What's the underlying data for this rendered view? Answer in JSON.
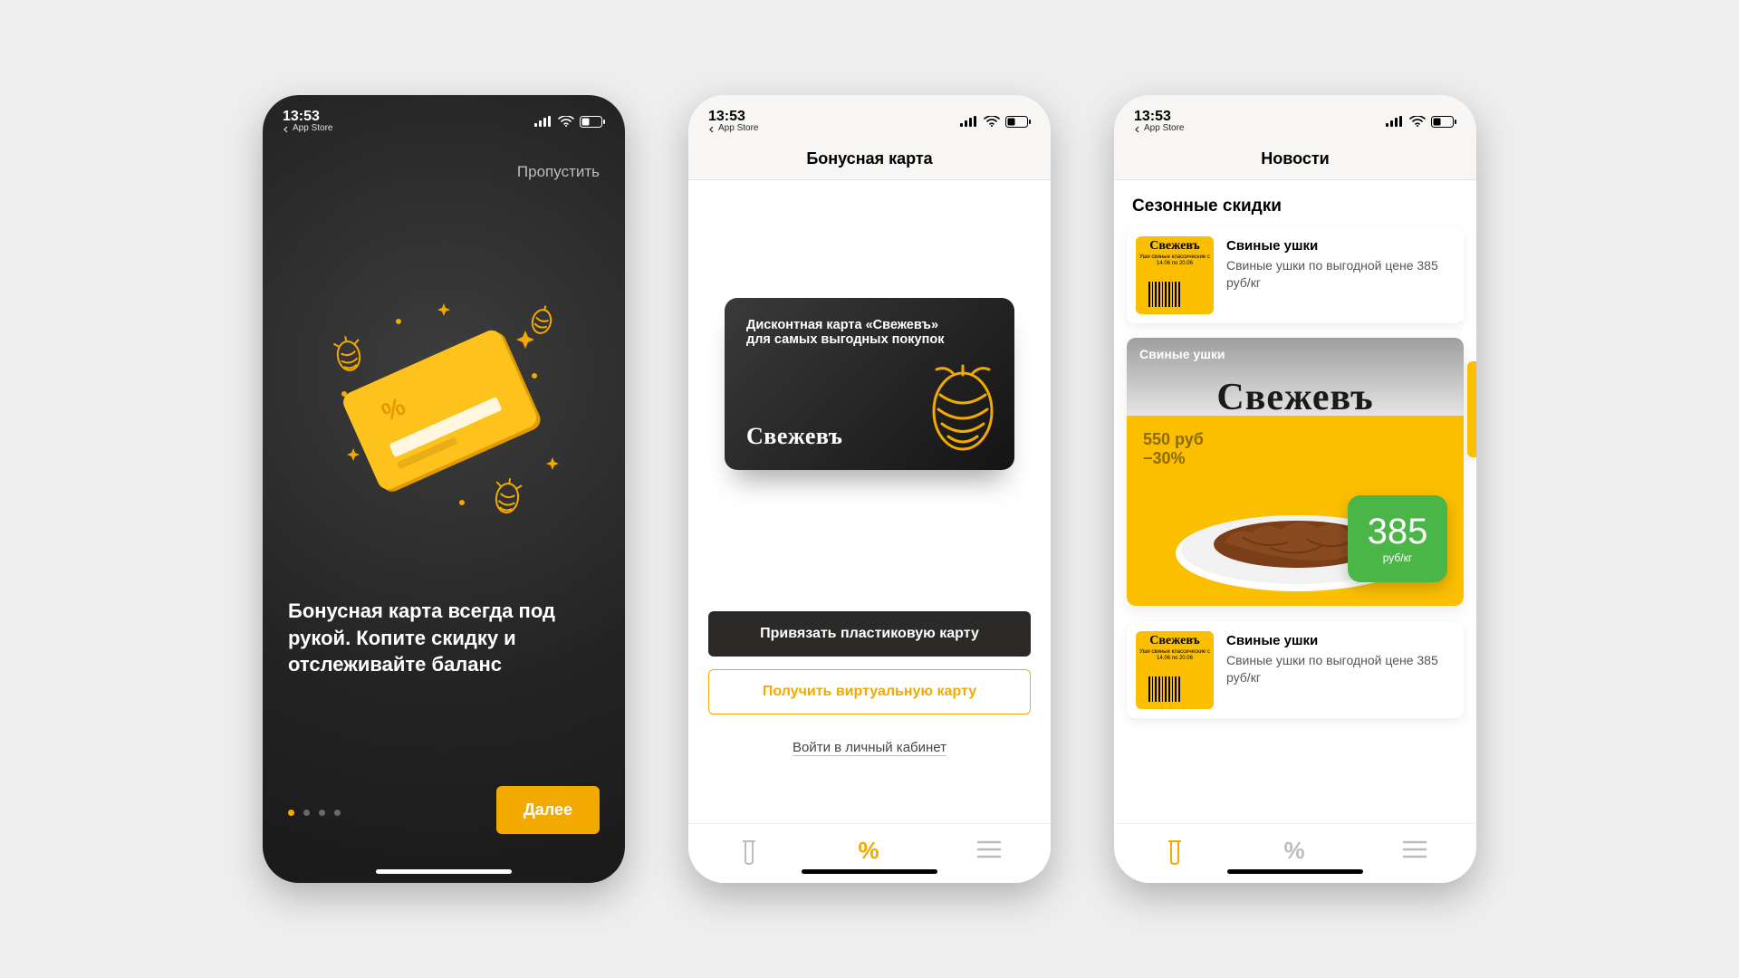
{
  "status": {
    "time": "13:53",
    "back_label": "App Store"
  },
  "colors": {
    "accent": "#f2a900",
    "promo_yellow": "#fbbf00",
    "price_green": "#4bb648"
  },
  "brand_name": "Свежевъ",
  "onboarding": {
    "skip": "Пропустить",
    "headline": "Бонусная карта всегда под рукой. Копите скидку и отслеживайте баланс",
    "next": "Далее",
    "page_count": 4,
    "page_active_index": 0
  },
  "bonus": {
    "nav_title": "Бонусная карта",
    "card_line1": "Дисконтная карта «Свежевъ»",
    "card_line2": "для самых выгодных покупок",
    "attach_plastic": "Привязать пластиковую карту",
    "get_virtual": "Получить виртуальную карту",
    "login_link": "Войти в личный кабинет",
    "tabbar_active_index": 1
  },
  "news": {
    "nav_title": "Новости",
    "section_title": "Сезонные скидки",
    "tabbar_active_index": 0,
    "thumb_meta": "Уши свиные классические с 14.06 по 20.06",
    "items": [
      {
        "title": "Свиные ушки",
        "desc": "Свиные ушки по выгодной цене 385 руб/кг"
      },
      {
        "title": "Свиные ушки",
        "desc": "Свиные ушки по выгодной цене 385 руб/кг"
      }
    ],
    "promo": {
      "heading": "Свиные ушки",
      "old_price": "550 руб",
      "discount": "−30%",
      "new_price": "385",
      "unit": "руб/кг"
    }
  }
}
